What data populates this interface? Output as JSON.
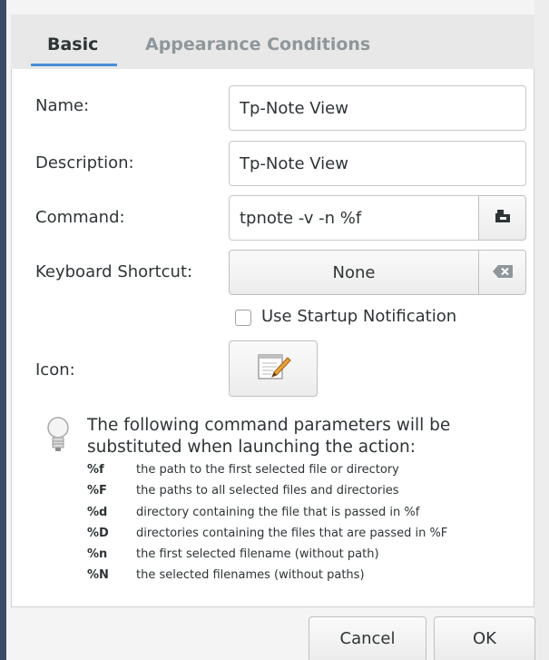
{
  "tabs": [
    {
      "label": "Basic",
      "active": true
    },
    {
      "label": "Appearance Conditions",
      "active": false
    }
  ],
  "form": {
    "name_label": "Name:",
    "name_value": "Tp-Note View",
    "description_label": "Description:",
    "description_value": "Tp-Note View",
    "command_label": "Command:",
    "command_value": "tpnote -v -n %f",
    "command_browse_icon": "folder-open-icon",
    "shortcut_label": "Keyboard Shortcut:",
    "shortcut_value": "None",
    "shortcut_clear_icon": "backspace-clear-icon",
    "startup_label": "Use Startup Notification",
    "startup_checked": false,
    "icon_label": "Icon:",
    "icon_name": "notepad-pencil-icon"
  },
  "info": {
    "icon": "lightbulb-icon",
    "text": "The following command parameters will be substituted when launching the action:",
    "params": [
      {
        "code": "%f",
        "desc": "the path to the first selected file or directory"
      },
      {
        "code": "%F",
        "desc": "the paths to all selected files and directories"
      },
      {
        "code": "%d",
        "desc": "directory containing the file that is passed in %f"
      },
      {
        "code": "%D",
        "desc": "directories containing the files that are passed in %F"
      },
      {
        "code": "%n",
        "desc": "the first selected filename (without path)"
      },
      {
        "code": "%N",
        "desc": "the selected filenames (without paths)"
      }
    ]
  },
  "footer": {
    "cancel_label": "Cancel",
    "ok_label": "OK"
  },
  "colors": {
    "accent": "#4a90d9",
    "window_border": "#3b4a66"
  }
}
